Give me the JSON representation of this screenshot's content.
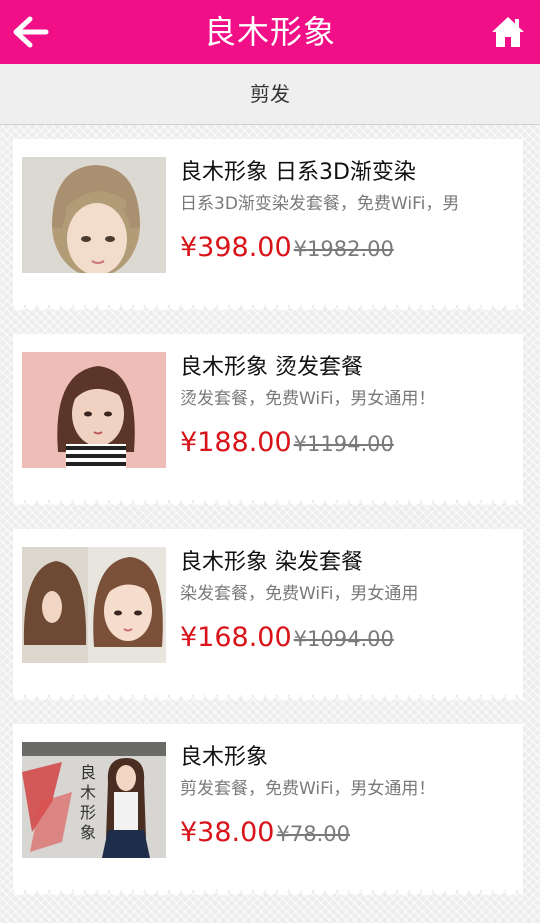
{
  "header": {
    "title": "良木形象",
    "back_icon": "arrow-left-icon",
    "home_icon": "home-icon"
  },
  "category": {
    "label": "剪发"
  },
  "colors": {
    "brand": "#f00f86",
    "price": "#d9131a"
  },
  "products": [
    {
      "name": "良木形象 日系3D渐变染",
      "desc": "日系3D渐变染发套餐，免费WiFi，男",
      "price": "¥398.00",
      "old_price": "¥1982.00"
    },
    {
      "name": "良木形象 烫发套餐",
      "desc": "烫发套餐，免费WiFi，男女通用！",
      "price": "¥188.00",
      "old_price": "¥1194.00"
    },
    {
      "name": "良木形象 染发套餐",
      "desc": "染发套餐，免费WiFi，男女通用",
      "price": "¥168.00",
      "old_price": "¥1094.00"
    },
    {
      "name": "良木形象",
      "desc": "剪发套餐，免费WiFi，男女通用！",
      "price": "¥38.00",
      "old_price": "¥78.00",
      "image_text": "良木形象"
    }
  ]
}
